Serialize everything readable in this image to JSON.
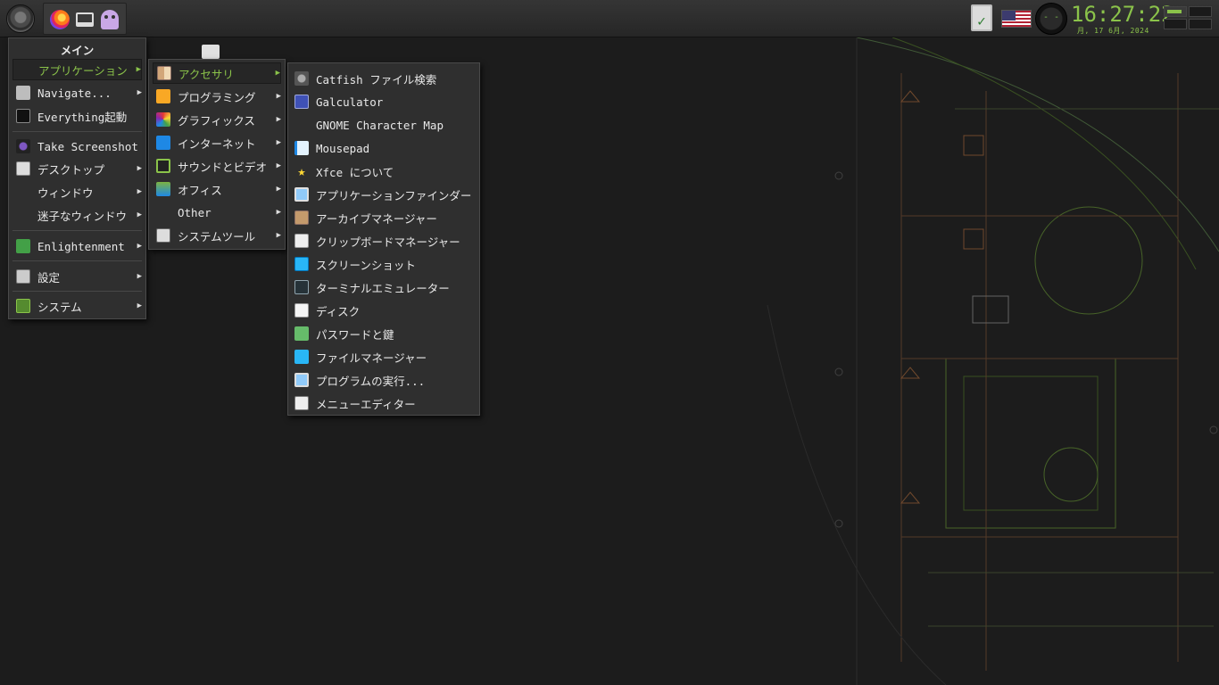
{
  "panel": {
    "clock_time": "16:27:22",
    "clock_date": "月, 17  6月, 2024"
  },
  "main_menu": {
    "title": "メイン",
    "items": [
      {
        "label": "アプリケーション",
        "icon": "none",
        "submenu": true,
        "highlighted": true
      },
      {
        "label": "Navigate...",
        "icon": "folder-icon",
        "submenu": true
      },
      {
        "label": "Everything起動",
        "icon": "terminal-icon",
        "submenu": false
      },
      {
        "label": "Take Screenshot",
        "icon": "camera-icon",
        "submenu": false
      },
      {
        "label": "デスクトップ",
        "icon": "desktop-icon",
        "submenu": true
      },
      {
        "label": "ウィンドウ",
        "icon": "none",
        "submenu": true
      },
      {
        "label": "迷子なウィンドウ",
        "icon": "none",
        "submenu": true
      },
      {
        "label": "Enlightenment",
        "icon": "enlightenment-icon",
        "submenu": true
      },
      {
        "label": "設定",
        "icon": "settings-icon",
        "submenu": true
      },
      {
        "label": "システム",
        "icon": "system-icon",
        "submenu": true
      }
    ]
  },
  "apps_menu": {
    "items": [
      {
        "label": "アクセサリ",
        "icon": "accessories-icon",
        "highlighted": true
      },
      {
        "label": "プログラミング",
        "icon": "programming-icon"
      },
      {
        "label": "グラフィックス",
        "icon": "graphics-icon"
      },
      {
        "label": "インターネット",
        "icon": "internet-icon"
      },
      {
        "label": "サウンドとビデオ",
        "icon": "multimedia-icon"
      },
      {
        "label": "オフィス",
        "icon": "office-icon"
      },
      {
        "label": "Other",
        "icon": "none"
      },
      {
        "label": "システムツール",
        "icon": "system-tools-icon"
      }
    ]
  },
  "accessories_menu": {
    "items": [
      {
        "label": "Catfish ファイル検索",
        "icon": "catfish-icon"
      },
      {
        "label": "Galculator",
        "icon": "calculator-icon"
      },
      {
        "label": "GNOME Character Map",
        "icon": "none"
      },
      {
        "label": "Mousepad",
        "icon": "text-editor-icon"
      },
      {
        "label": "Xfce について",
        "icon": "star-icon"
      },
      {
        "label": "アプリケーションファインダー",
        "icon": "app-finder-icon"
      },
      {
        "label": "アーカイブマネージャー",
        "icon": "archive-icon"
      },
      {
        "label": "クリップボードマネージャー",
        "icon": "clipboard-icon"
      },
      {
        "label": "スクリーンショット",
        "icon": "screenshot-icon"
      },
      {
        "label": "ターミナルエミュレーター",
        "icon": "terminal-icon"
      },
      {
        "label": "ディスク",
        "icon": "disk-icon"
      },
      {
        "label": "パスワードと鍵",
        "icon": "key-icon"
      },
      {
        "label": "ファイルマネージャー",
        "icon": "file-manager-icon"
      },
      {
        "label": "プログラムの実行...",
        "icon": "run-icon"
      },
      {
        "label": "メニューエディター",
        "icon": "menu-editor-icon"
      }
    ]
  },
  "colors": {
    "accent": "#8bc34a",
    "menu_bg": "#2f2f2f",
    "panel_bg": "#2e2e2e",
    "desktop_bg": "#1c1c1c"
  }
}
